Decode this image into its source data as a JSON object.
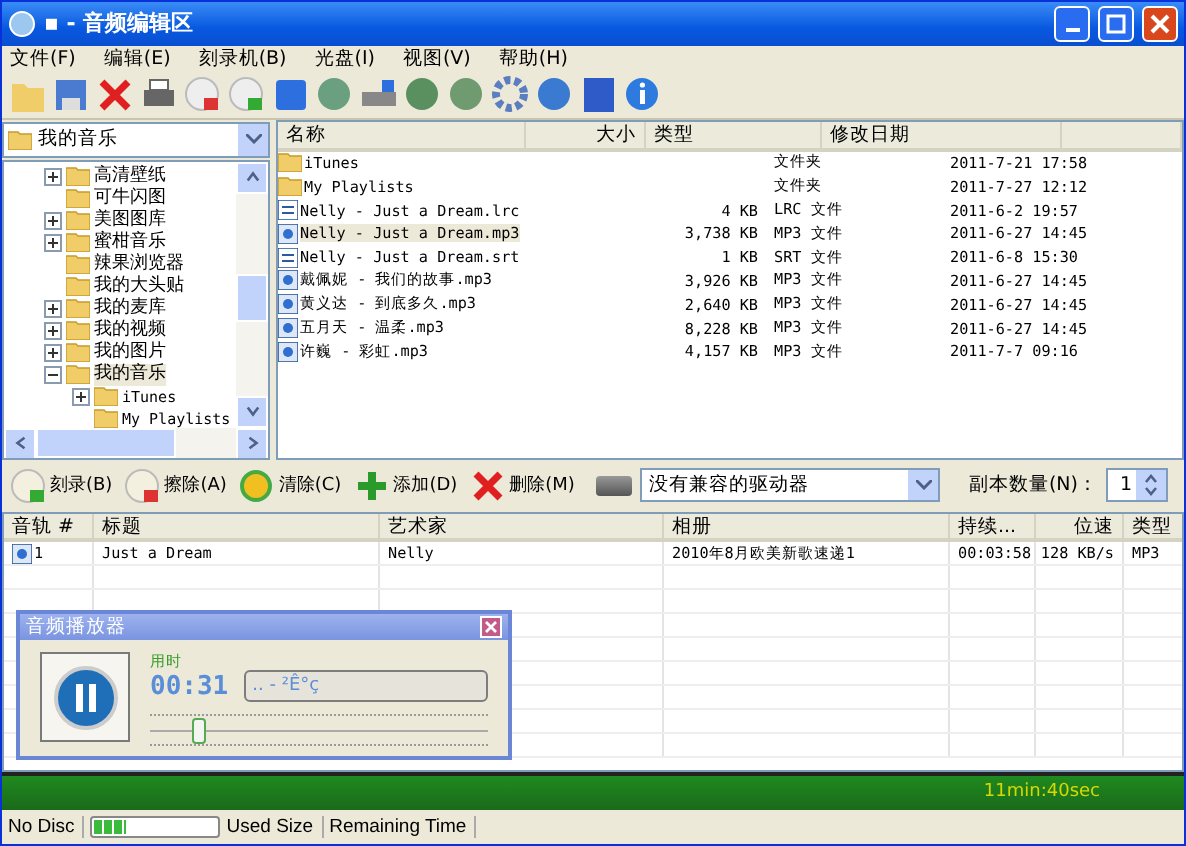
{
  "window": {
    "title": "▪ - 音频编辑区"
  },
  "menu": [
    "文件(F)",
    "编辑(E)",
    "刻录机(B)",
    "光盘(I)",
    "视图(V)",
    "帮助(H)"
  ],
  "tree": {
    "location": "我的音乐",
    "items": [
      {
        "label": "高清壁纸",
        "expandable": true,
        "expanded": false,
        "selected": false
      },
      {
        "label": "可牛闪图",
        "expandable": false,
        "selected": false
      },
      {
        "label": "美图图库",
        "expandable": true,
        "expanded": false,
        "selected": false
      },
      {
        "label": "蜜柑音乐",
        "expandable": true,
        "expanded": false,
        "selected": false
      },
      {
        "label": "辣果浏览器",
        "expandable": false,
        "selected": false
      },
      {
        "label": "我的大头贴",
        "expandable": false,
        "selected": false
      },
      {
        "label": "我的麦库",
        "expandable": true,
        "expanded": false,
        "selected": false
      },
      {
        "label": "我的视频",
        "expandable": true,
        "expanded": false,
        "selected": false
      },
      {
        "label": "我的图片",
        "expandable": true,
        "expanded": false,
        "selected": false
      },
      {
        "label": "我的音乐",
        "expandable": true,
        "expanded": true,
        "selected": true,
        "children": [
          {
            "label": "iTunes",
            "expandable": true,
            "expanded": false,
            "selected": false
          },
          {
            "label": "My Playlists",
            "expandable": false,
            "selected": false
          }
        ]
      }
    ]
  },
  "files": {
    "columns": [
      "名称",
      "大小",
      "类型",
      "修改日期"
    ],
    "rows": [
      {
        "kind": "folder",
        "name": "iTunes",
        "size": "",
        "type": "文件夹",
        "date": "2011-7-21 17:58",
        "selected": false
      },
      {
        "kind": "folder",
        "name": "My Playlists",
        "size": "",
        "type": "文件夹",
        "date": "2011-7-27 12:12",
        "selected": false
      },
      {
        "kind": "text",
        "name": "Nelly - Just a Dream.lrc",
        "size": "4 KB",
        "type": "LRC 文件",
        "date": "2011-6-2 19:57",
        "selected": false
      },
      {
        "kind": "audio",
        "name": "Nelly - Just a Dream.mp3",
        "size": "3,738 KB",
        "type": "MP3 文件",
        "date": "2011-6-27 14:45",
        "selected": true
      },
      {
        "kind": "text",
        "name": "Nelly - Just a Dream.srt",
        "size": "1 KB",
        "type": "SRT 文件",
        "date": "2011-6-8 15:30",
        "selected": false
      },
      {
        "kind": "audio",
        "name": "戴佩妮 - 我们的故事.mp3",
        "size": "3,926 KB",
        "type": "MP3 文件",
        "date": "2011-6-27 14:45",
        "selected": false
      },
      {
        "kind": "audio",
        "name": "黄义达 - 到底多久.mp3",
        "size": "2,640 KB",
        "type": "MP3 文件",
        "date": "2011-6-27 14:45",
        "selected": false
      },
      {
        "kind": "audio",
        "name": "五月天 - 温柔.mp3",
        "size": "8,228 KB",
        "type": "MP3 文件",
        "date": "2011-6-27 14:45",
        "selected": false
      },
      {
        "kind": "audio",
        "name": "许巍 - 彩虹.mp3",
        "size": "4,157 KB",
        "type": "MP3 文件",
        "date": "2011-7-7 09:16",
        "selected": false
      }
    ]
  },
  "burn_toolbar": {
    "buttons": [
      {
        "kind": "burn",
        "label": "刻录(B)"
      },
      {
        "kind": "erase",
        "label": "擦除(A)"
      },
      {
        "kind": "clear",
        "label": "清除(C)"
      },
      {
        "kind": "add",
        "label": "添加(D)"
      },
      {
        "kind": "delete",
        "label": "删除(M)"
      }
    ],
    "drive": "没有兼容的驱动器",
    "copies_label": "副本数量(N)：",
    "copies": "1"
  },
  "tracks": {
    "columns": [
      "音轨 #",
      "标题",
      "艺术家",
      "相册",
      "持续...",
      "位速",
      "类型"
    ],
    "rows": [
      [
        "1",
        "Just a Dream",
        "Nelly",
        "2010年8月欧美新歌速递1",
        "00:03:58",
        "128 KB/s",
        "MP3"
      ]
    ]
  },
  "player": {
    "title": "音频播放器",
    "elapsed_label": "用时",
    "time": "00:31",
    "display": ".. - ²Ê°ç",
    "level": 0.14
  },
  "capacity": {
    "text": "11min:40sec",
    "level": 1
  },
  "status_bar": {
    "disc": "No Disc",
    "level": 0.25,
    "used": "Used Size",
    "remaining": "Remaining Time"
  }
}
